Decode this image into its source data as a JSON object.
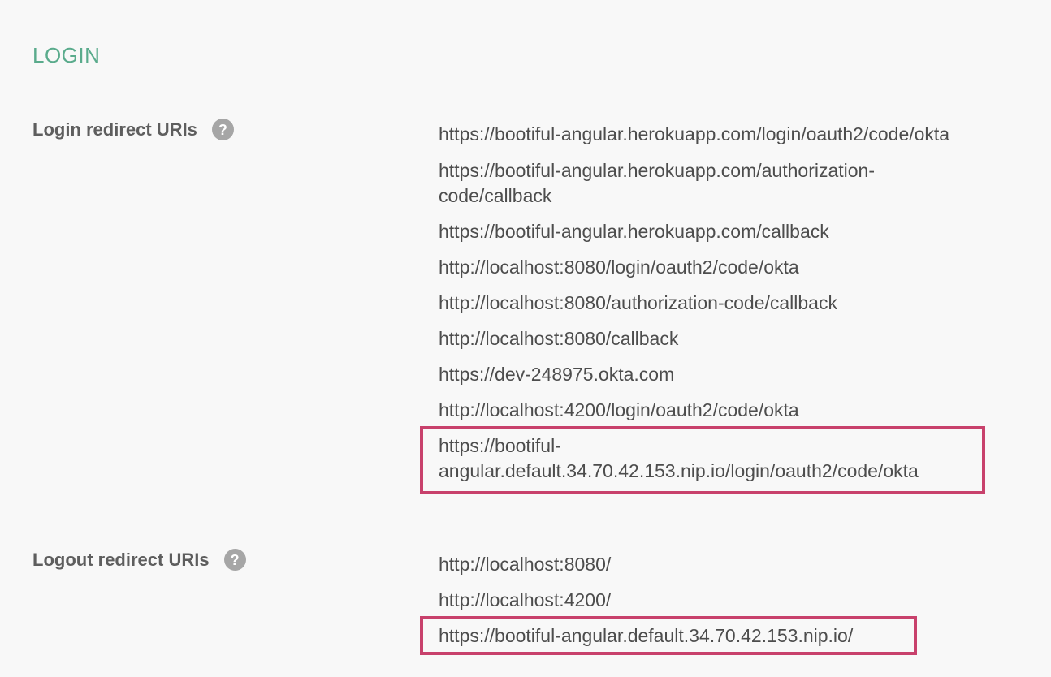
{
  "section": {
    "title": "LOGIN"
  },
  "login_redirect": {
    "label": "Login redirect URIs",
    "help_icon": "?",
    "uris": [
      [
        "https://bootiful-angular.herokuapp.com/login/oauth2/code/okta"
      ],
      [
        "https://bootiful-angular.herokuapp.com/authorization-",
        "code/callback"
      ],
      [
        "https://bootiful-angular.herokuapp.com/callback"
      ],
      [
        "http://localhost:8080/login/oauth2/code/okta"
      ],
      [
        "http://localhost:8080/authorization-code/callback"
      ],
      [
        "http://localhost:8080/callback"
      ],
      [
        "https://dev-248975.okta.com"
      ],
      [
        "http://localhost:4200/login/oauth2/code/okta"
      ],
      [
        "https://bootiful-",
        "angular.default.34.70.42.153.nip.io/login/oauth2/code/okta"
      ]
    ]
  },
  "logout_redirect": {
    "label": "Logout redirect URIs",
    "help_icon": "?",
    "uris": [
      [
        "http://localhost:8080/"
      ],
      [
        "http://localhost:4200/"
      ],
      [
        "https://bootiful-angular.default.34.70.42.153.nip.io/"
      ]
    ]
  },
  "colors": {
    "accent": "#5aab8c",
    "highlight": "#c8416c",
    "text": "#4d4d4d",
    "background": "#f8f8f8"
  }
}
